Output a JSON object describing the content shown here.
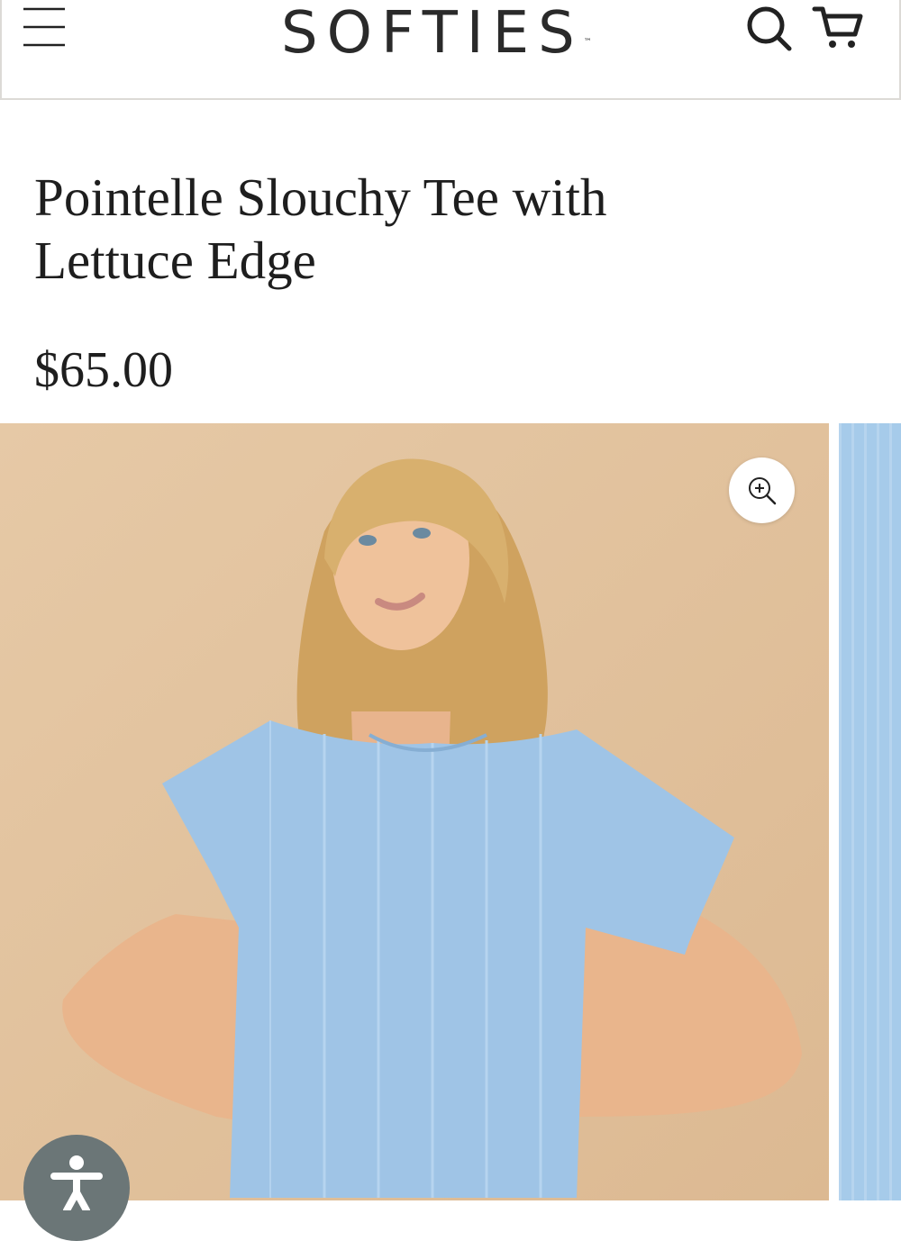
{
  "header": {
    "menu_icon": "hamburger-menu-icon",
    "logo_text": "SOFTIES",
    "logo_trademark": "™",
    "search_icon": "search-icon",
    "cart_icon": "cart-icon"
  },
  "product": {
    "title": "Pointelle Slouchy Tee with Lettuce Edge",
    "price": "$65.00"
  },
  "gallery": {
    "zoom_icon": "zoom-in-icon",
    "main_background_color": "#e2c3a0",
    "shirt_color": "#9fc4e6"
  },
  "accessibility": {
    "icon": "accessibility-icon"
  }
}
